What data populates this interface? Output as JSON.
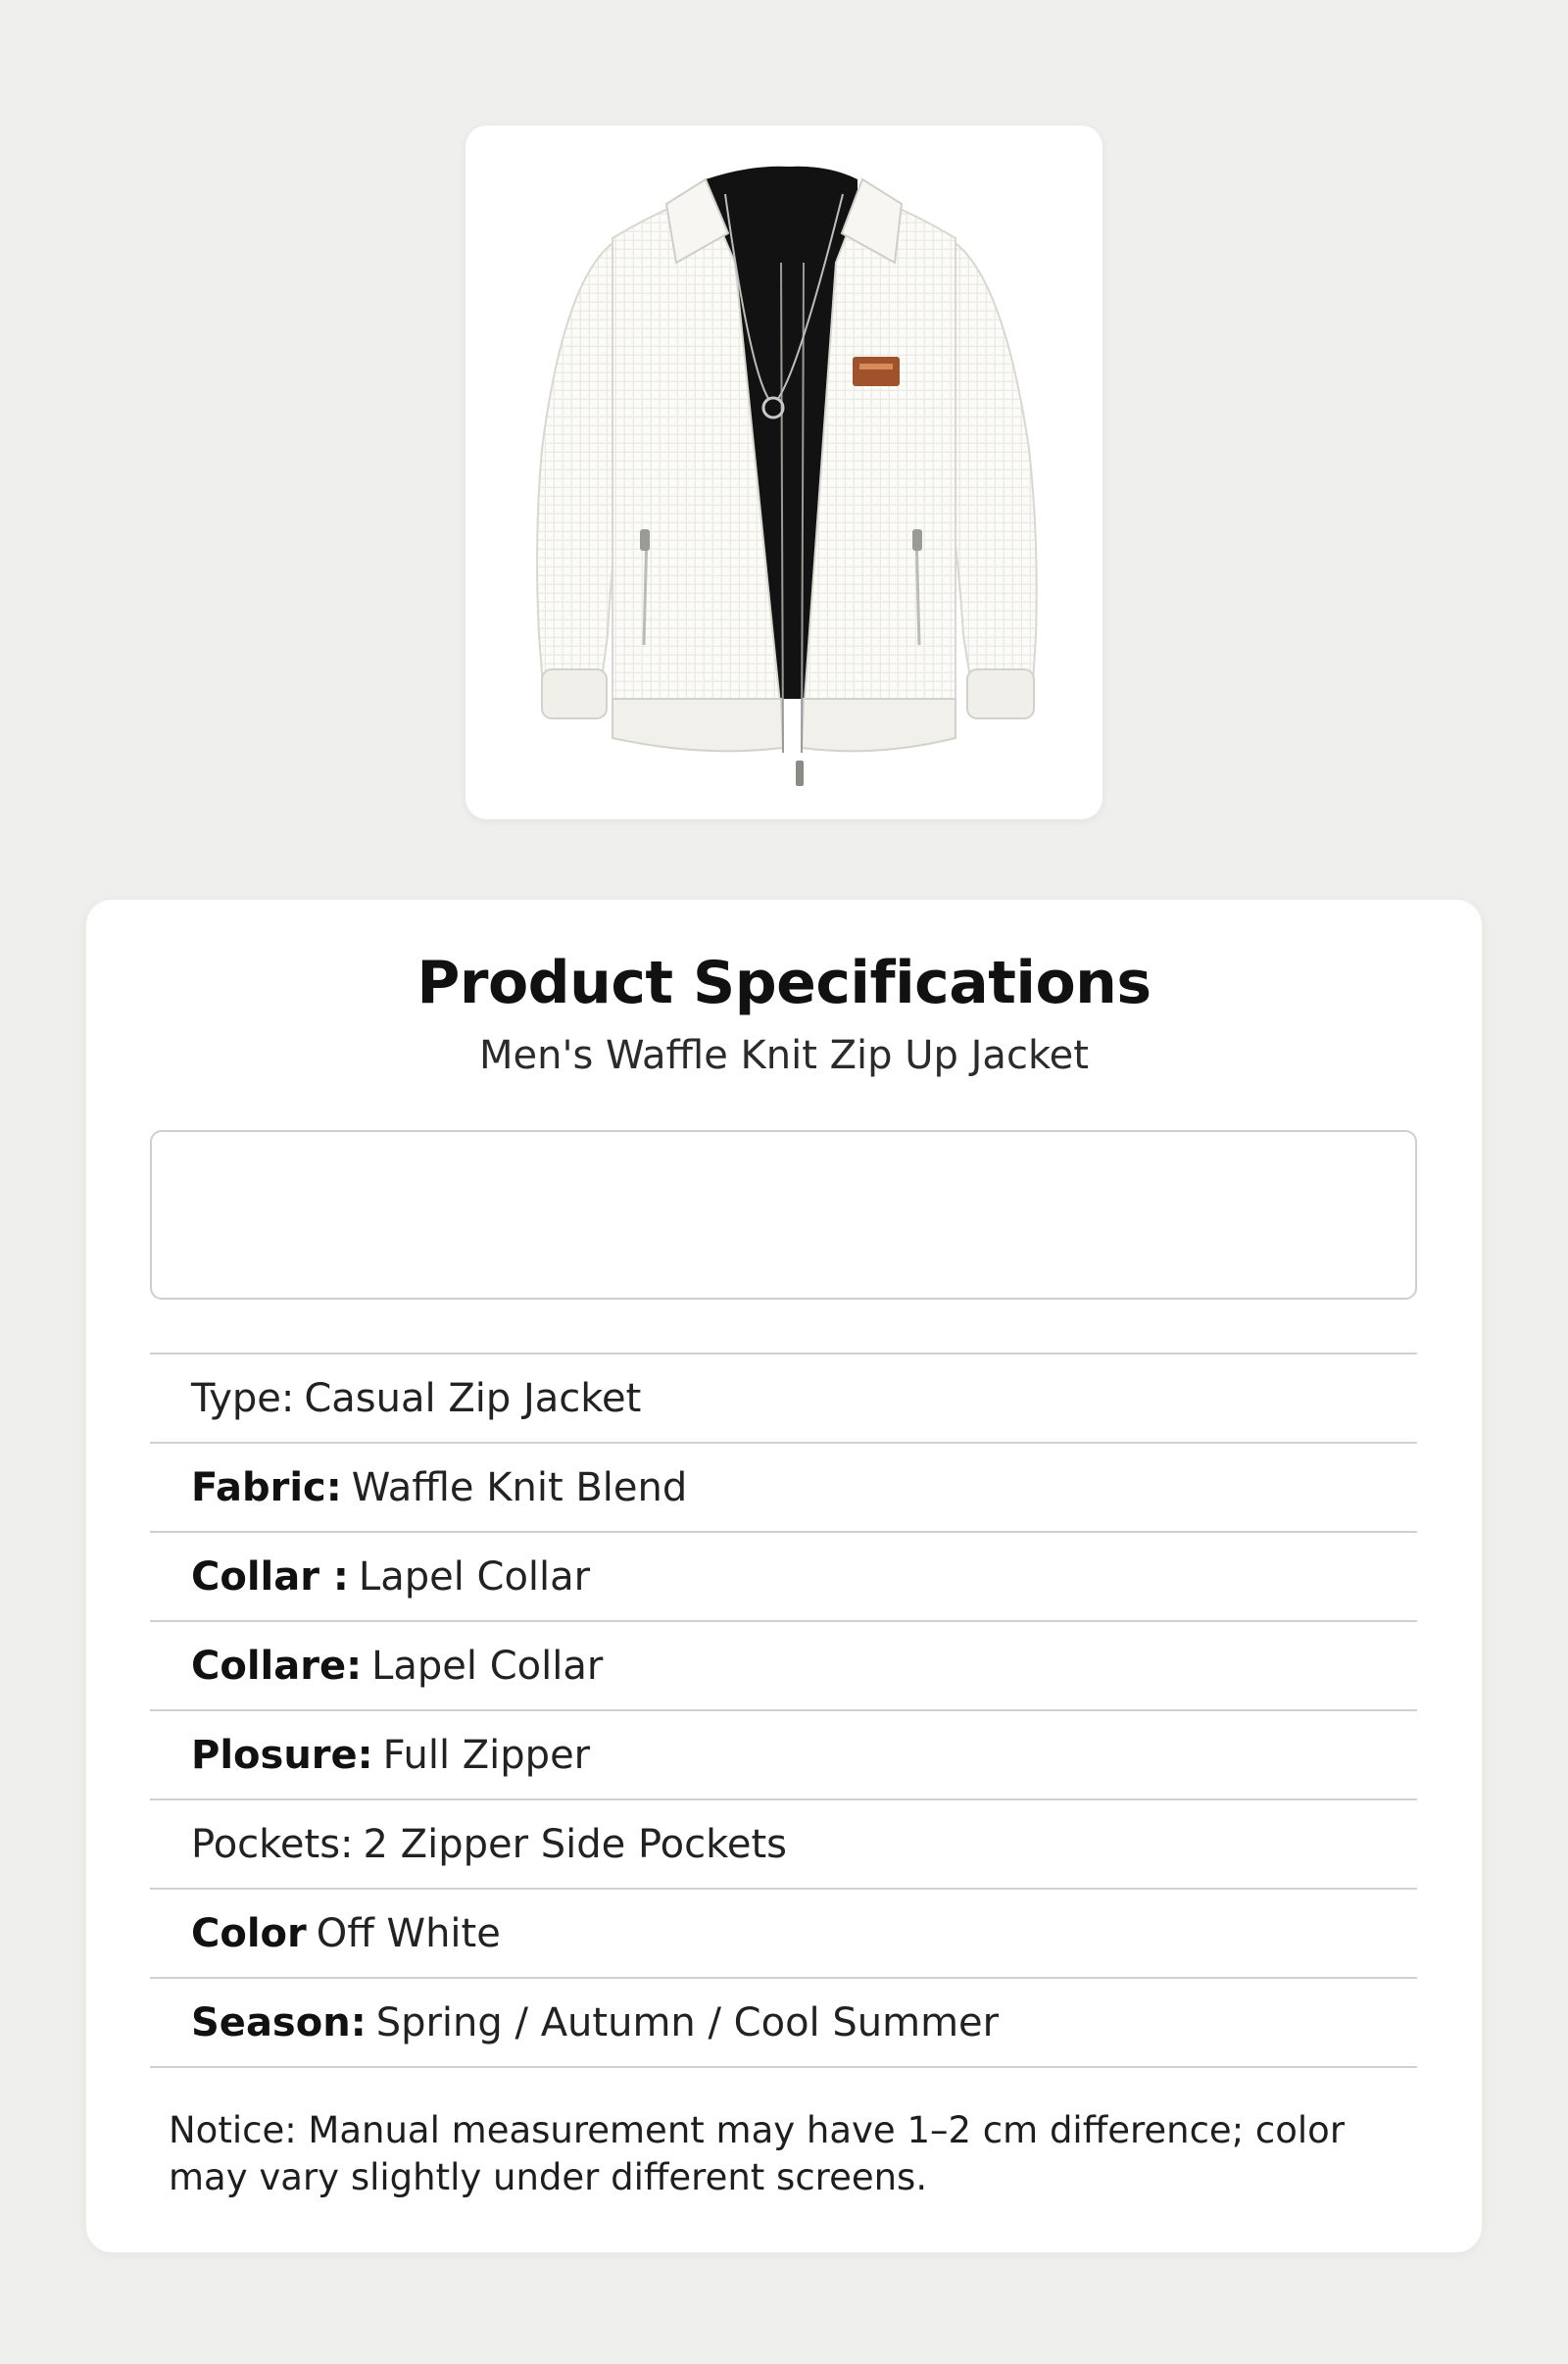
{
  "product_image": {
    "alt": "Men's off-white waffle knit zip up jacket over black t-shirt with necklace",
    "colors": {
      "jacket": "#f4f3ee",
      "shirt": "#121212",
      "patch": "#a0522d"
    }
  },
  "spec": {
    "title": "Product Specifications",
    "subtitle": "Men's Waffle Knit Zip Up Jacket",
    "rows": [
      {
        "label": "Type:",
        "value": "Casual Zip Jacket",
        "bold": false
      },
      {
        "label": "Fabric:",
        "value": "Waffle Knit Blend",
        "bold": true
      },
      {
        "label": "Collar :",
        "value": "Lapel Collar",
        "bold": true
      },
      {
        "label": "Collare:",
        "value": "Lapel Collar",
        "bold": true
      },
      {
        "label": "Plosure:",
        "value": "Full Zipper",
        "bold": true
      },
      {
        "label": "Pockets:",
        "value": "2 Zipper Side Pockets",
        "bold": false
      },
      {
        "label": "Color",
        "value": "Off White",
        "bold": true
      },
      {
        "label": "Season:",
        "value": "Spring / Autumn / Cool Summer",
        "bold": true
      }
    ],
    "notice": "Notice: Manual measurement may have 1–2 cm difference; color may vary slightly under different screens."
  }
}
